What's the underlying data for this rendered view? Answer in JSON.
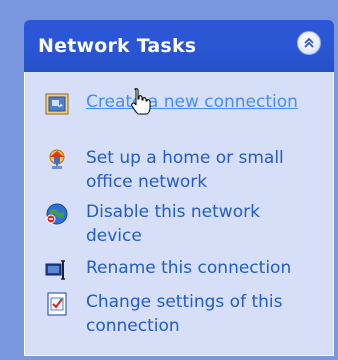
{
  "panel": {
    "title": "Network Tasks",
    "collapse_icon": "chevron-double-up-icon",
    "colors": {
      "header": "#2c57d8",
      "body": "#d6dff7",
      "link": "#215dc6",
      "link_hover": "#428eff"
    }
  },
  "tasks": [
    {
      "label": "Create a new connection",
      "icon": "new-connection-icon",
      "hovered": true
    },
    {
      "label": "Set up a home or small office network",
      "icon": "home-network-icon"
    },
    {
      "label": "Disable this network device",
      "icon": "disable-network-icon"
    },
    {
      "label": "Rename this connection",
      "icon": "rename-icon"
    },
    {
      "label": "Change settings of this connection",
      "icon": "settings-icon"
    }
  ]
}
